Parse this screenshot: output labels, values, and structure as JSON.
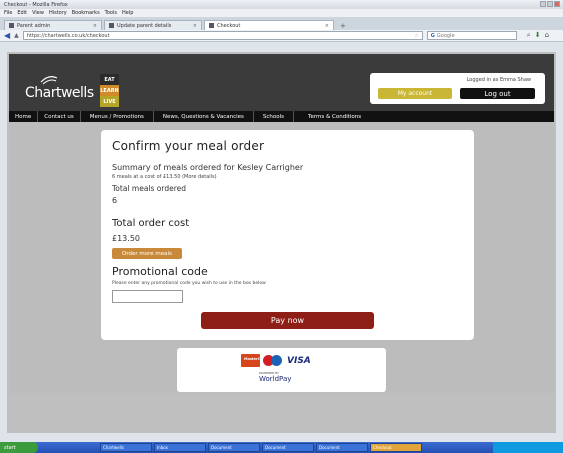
{
  "browser": {
    "title": "Checkout - Mozilla Firefox",
    "menu": [
      "File",
      "Edit",
      "View",
      "History",
      "Bookmarks",
      "Tools",
      "Help"
    ],
    "tabs": [
      {
        "label": "Parent admin"
      },
      {
        "label": "Update parent details"
      },
      {
        "label": "Checkout"
      }
    ],
    "url": "https://chartwells.co.uk/checkout",
    "search_placeholder": "Google"
  },
  "site": {
    "logo": "Chartwells",
    "eat_block": [
      "EAT",
      "LEARN",
      "LIVE"
    ],
    "logged_in": "Logged in as Emma Shaw",
    "my_account": "My account",
    "logout": "Log out",
    "nav": [
      "Home",
      "Contact us",
      "Menus / Promotions",
      "News, Questions & Vacancies",
      "Schools",
      "Terms & Conditions"
    ]
  },
  "order": {
    "heading": "Confirm your meal order",
    "summary": "Summary of meals ordered for Kesley Carrigher",
    "summary_small": "6 meals at a cost of £13.50 (More details)",
    "total_meals_label": "Total meals ordered",
    "total_meals_value": "6",
    "total_cost_label": "Total order cost",
    "total_cost_value": "£13.50",
    "order_more_button": "Order more meals",
    "promo_label": "Promotional code",
    "promo_help": "Please enter any promotional code you wish to use in the box below",
    "promo_value": "",
    "pay_button": "Pay now"
  },
  "payment": {
    "visa": "VISA",
    "mastercard": "MasterCard",
    "powered_by": "POWERED BY",
    "worldpay": "WorldPay"
  },
  "taskbar": {
    "start": "start",
    "tasks": [
      "Chartwells",
      "Inbox",
      "Document",
      "Document",
      "Document",
      "Checkout"
    ]
  }
}
